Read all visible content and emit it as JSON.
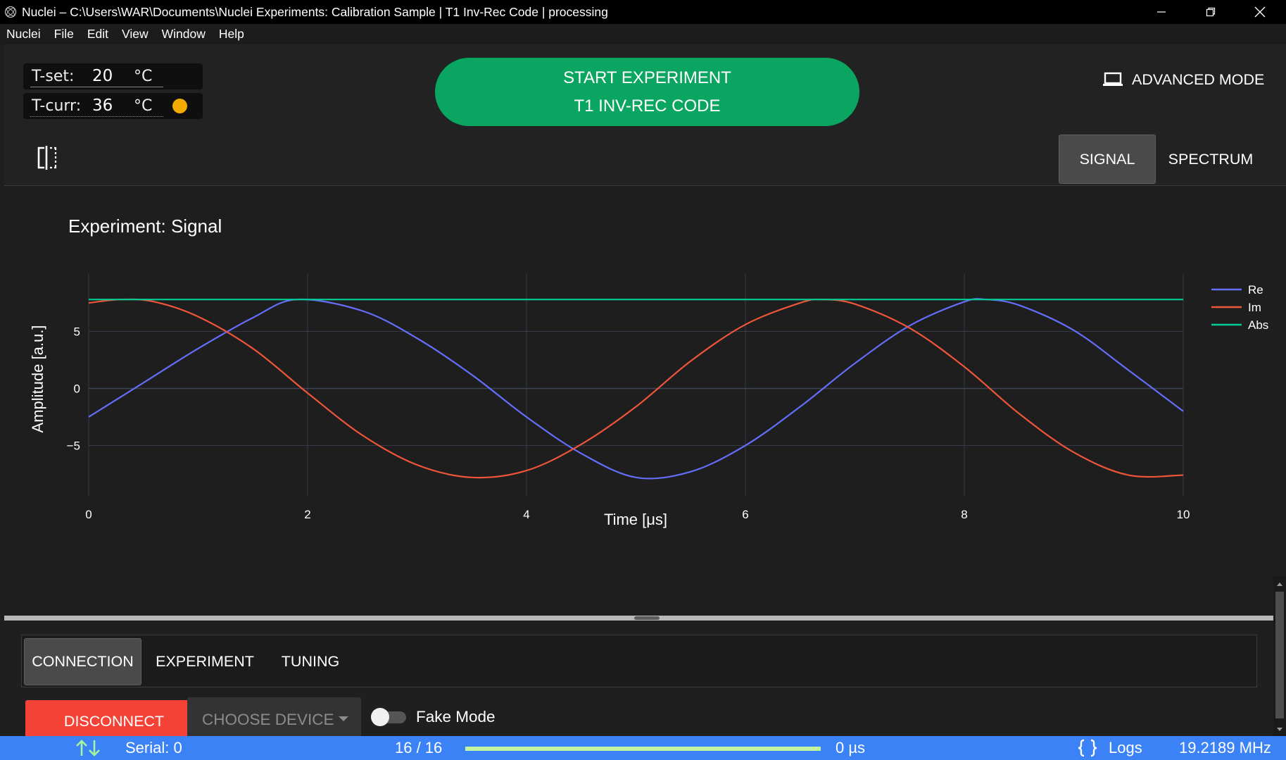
{
  "window": {
    "title": "Nuclei – C:\\Users\\WAR\\Documents\\Nuclei Experiments: Calibration Sample | T1 Inv-Rec Code | processing",
    "app_icon": "nuclei-app-icon",
    "controls": [
      "minimize-icon",
      "restore-icon",
      "close-icon"
    ]
  },
  "menu": [
    "Nuclei",
    "File",
    "Edit",
    "View",
    "Window",
    "Help"
  ],
  "temperature": {
    "set_label": "T-set:",
    "set_value": "20",
    "curr_label": "T-curr:",
    "curr_value": "36",
    "unit": "°C",
    "status_color": "#f2a900"
  },
  "start_button": {
    "line1": "START EXPERIMENT",
    "line2": "T1 INV-REC CODE",
    "color": "#0aa560"
  },
  "advanced_mode": {
    "label": "ADVANCED MODE",
    "icon": "laptop-icon"
  },
  "view_tabs": [
    {
      "label": "SIGNAL",
      "active": true
    },
    {
      "label": "SPECTRUM",
      "active": false
    }
  ],
  "chart_data": {
    "type": "line",
    "title": "Experiment: Signal",
    "xlabel": "Time [μs]",
    "ylabel": "Amplitude [a.u.]",
    "xlim": [
      0,
      10
    ],
    "ylim": [
      -8.8,
      8.8
    ],
    "xticks": [
      "0",
      "2",
      "4",
      "6",
      "8",
      "10"
    ],
    "yticks": [
      "−5",
      "0",
      "5"
    ],
    "grid": true,
    "legend_position": "right",
    "series": [
      {
        "name": "Re",
        "color": "#636efa",
        "x": [
          0,
          0.5,
          1,
          1.5,
          1.9,
          2.5,
          3,
          3.5,
          4,
          4.5,
          5,
          5.5,
          6,
          6.5,
          7,
          7.5,
          8,
          8.2,
          8.5,
          9,
          9.5,
          10
        ],
        "y": [
          -2.5,
          0.5,
          3.5,
          6.2,
          7.8,
          6.8,
          4.4,
          1.2,
          -2.5,
          -5.7,
          -7.8,
          -7.3,
          -5,
          -1.6,
          2.2,
          5.5,
          7.6,
          7.8,
          7.3,
          5.1,
          1.6,
          -2
        ]
      },
      {
        "name": "Im",
        "color": "#ef553b",
        "x": [
          0,
          0.3,
          0.6,
          1,
          1.5,
          2,
          2.5,
          3,
          3.5,
          4,
          4.5,
          5,
          5.5,
          6,
          6.5,
          6.7,
          7,
          7.5,
          8,
          8.5,
          9,
          9.5,
          10
        ],
        "y": [
          7.5,
          7.8,
          7.6,
          6.3,
          3.5,
          -0.4,
          -4.1,
          -6.7,
          -7.8,
          -7.2,
          -4.9,
          -1.6,
          2.4,
          5.6,
          7.5,
          7.8,
          7.4,
          5.3,
          1.9,
          -2.2,
          -5.6,
          -7.6,
          -7.6
        ]
      },
      {
        "name": "Abs",
        "color": "#00cc96",
        "x": [
          0,
          10
        ],
        "y": [
          7.8,
          7.8
        ]
      }
    ]
  },
  "bottom_tabs": [
    {
      "label": "CONNECTION",
      "active": true
    },
    {
      "label": "EXPERIMENT",
      "active": false
    },
    {
      "label": "TUNING",
      "active": false
    }
  ],
  "connection": {
    "disconnect_label": "DISCONNECT",
    "disconnect_color": "#f44336",
    "device_placeholder": "CHOOSE DEVICE",
    "fake_mode_label": "Fake Mode",
    "fake_mode_on": false
  },
  "status": {
    "serial": "Serial: 0",
    "progress_text": "16 / 16",
    "progress_fraction": 1.0,
    "time": "0 µs",
    "logs_label": "Logs",
    "frequency": "19.2189 MHz",
    "serial_icon": "transfer-arrows-icon",
    "logs_icon": "braces-icon"
  }
}
